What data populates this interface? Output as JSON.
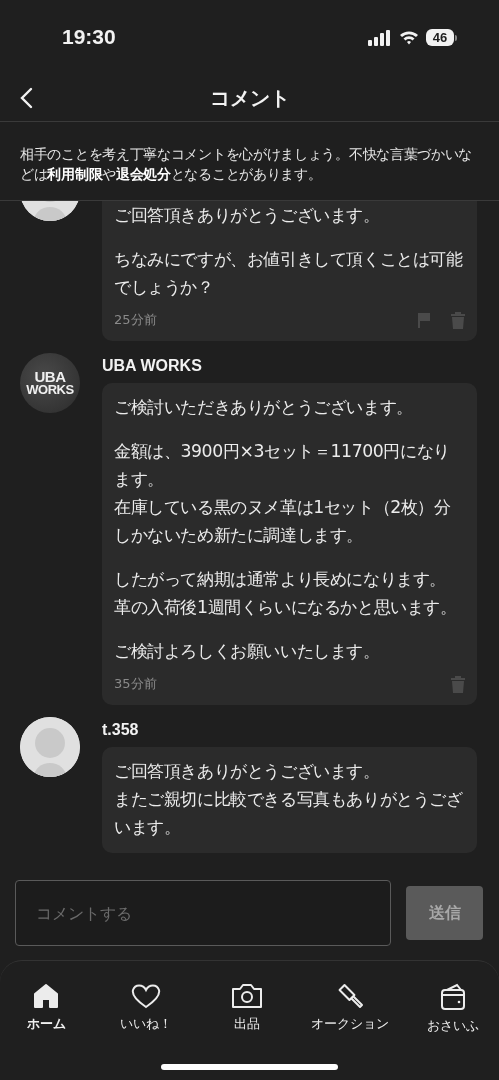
{
  "status_bar": {
    "time": "19:30",
    "battery": "46"
  },
  "header": {
    "title": "コメント"
  },
  "notice": "相手のことを考え丁寧なコメントを心がけましょう。不快な言葉づかいなどは**利用制限**や**退会処分**となることがあります。",
  "comments": [
    {
      "paragraphs": [
        [
          "ご回答頂きありがとうございます。"
        ],
        [
          "ちなみにですが、お値引きして頂くことは可能でしょうか？"
        ]
      ],
      "time": "25分前",
      "can_report": true,
      "can_delete": true
    },
    {
      "author": "UBA WORKS",
      "avatar_text": [
        "UBA",
        "WORKS"
      ],
      "paragraphs": [
        [
          "ご検討いただきありがとうございます。"
        ],
        [
          "金額は、3900円×3セット＝11700円になります。",
          "在庫している黒のヌメ革は1セット（2枚）分しかないため新たに調達します。"
        ],
        [
          "したがって納期は通常より長めになります。",
          "革の入荷後1週間くらいになるかと思います。"
        ],
        [
          "ご検討よろしくお願いいたします。"
        ]
      ],
      "time": "35分前",
      "can_report": false,
      "can_delete": true
    },
    {
      "author": "t.358",
      "paragraphs": [
        [
          "ご回答頂きありがとうございます。",
          "またご親切に比較できる写真もありがとうございます。"
        ]
      ]
    }
  ],
  "composer": {
    "placeholder": "コメントする",
    "send": "送信",
    "disabled": true
  },
  "tabs": [
    {
      "label": "ホーム",
      "selected": true
    },
    {
      "label": "いいね！",
      "selected": false
    },
    {
      "label": "出品",
      "selected": false
    },
    {
      "label": "オークション",
      "selected": false
    },
    {
      "label": "おさいふ",
      "selected": false
    }
  ]
}
